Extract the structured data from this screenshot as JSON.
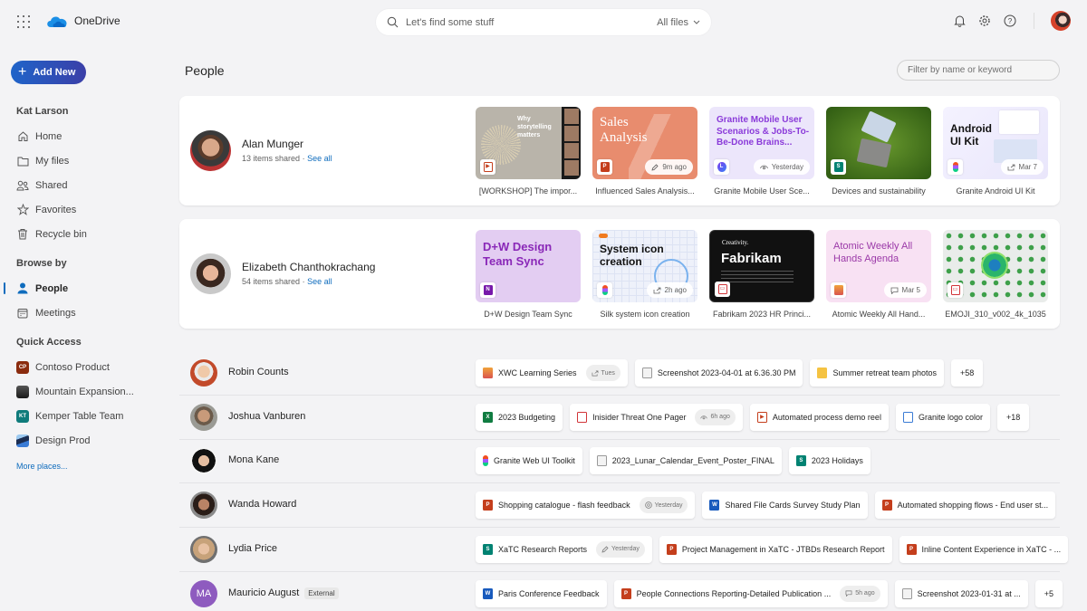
{
  "app": {
    "name": "OneDrive"
  },
  "search": {
    "placeholder": "Let's find some stuff",
    "scope": "All files"
  },
  "sidebar": {
    "add_new": "Add New",
    "user": "Kat Larson",
    "nav": [
      {
        "label": "Home",
        "icon": "home-icon"
      },
      {
        "label": "My files",
        "icon": "folder-icon"
      },
      {
        "label": "Shared",
        "icon": "people-icon"
      },
      {
        "label": "Favorites",
        "icon": "star-icon"
      },
      {
        "label": "Recycle bin",
        "icon": "trash-icon"
      }
    ],
    "browse_heading": "Browse by",
    "browse": [
      {
        "label": "People",
        "icon": "person-icon",
        "active": true
      },
      {
        "label": "Meetings",
        "icon": "calendar-icon"
      }
    ],
    "quick_heading": "Quick Access",
    "quick": [
      {
        "label": "Contoso Product",
        "badge": "CP",
        "color": "#8a2b0e"
      },
      {
        "label": "Mountain Expansion...",
        "badge": "",
        "color": "#2b2b2b"
      },
      {
        "label": "Kemper Table Team",
        "badge": "KT",
        "color": "#0f7b7b"
      },
      {
        "label": "Design Prod",
        "badge": "",
        "color": "#1e3a6b"
      }
    ],
    "more_places": "More places..."
  },
  "main": {
    "title": "People",
    "filter_placeholder": "Filter by name or keyword",
    "featured": [
      {
        "name": "Alan Munger",
        "items": "13 items shared",
        "see_all": "See all",
        "files": [
          {
            "name": "[WORKSHOP] The impor...",
            "thumb_title": "Why storytelling matters",
            "type": "video",
            "activity": ""
          },
          {
            "name": "Influenced Sales Analysis...",
            "thumb_title": "Sales Analysis",
            "type": "powerpoint",
            "activity": "9m ago",
            "activity_icon": "pencil-icon"
          },
          {
            "name": "Granite Mobile User Sce...",
            "thumb_title": "Granite Mobile User Scenarios & Jobs-To-Be-Done Brains...",
            "type": "loop",
            "activity": "Yesterday",
            "activity_icon": "eye-icon"
          },
          {
            "name": "Devices and sustainability",
            "thumb_title": "",
            "type": "sway",
            "activity": ""
          },
          {
            "name": "Granite Android UI Kit",
            "thumb_title": "Android UI Kit",
            "type": "figma",
            "activity": "Mar 7",
            "activity_icon": "share-icon"
          }
        ]
      },
      {
        "name": "Elizabeth Chanthokrachang",
        "items": "54 items shared",
        "see_all": "See all",
        "files": [
          {
            "name": "D+W Design Team Sync",
            "thumb_title": "D+W Design Team Sync",
            "type": "onenote",
            "activity": ""
          },
          {
            "name": "Silk system icon creation",
            "thumb_title": "System icon creation",
            "type": "figma",
            "activity": "2h ago",
            "activity_icon": "share-icon"
          },
          {
            "name": "Fabrikam 2023 HR Princi...",
            "thumb_title": "Fabrikam",
            "thumb_sub": "Creativity.",
            "type": "pdf",
            "activity": ""
          },
          {
            "name": "Atomic Weekly All Hand...",
            "thumb_title": "Atomic Weekly All Hands Agenda",
            "type": "forms",
            "activity": "Mar 5",
            "activity_icon": "comment-icon"
          },
          {
            "name": "EMOJI_310_v002_4k_1035",
            "thumb_title": "",
            "type": "pdf",
            "activity": ""
          }
        ]
      }
    ],
    "people": [
      {
        "name": "Robin Counts",
        "external": "",
        "files": [
          {
            "name": "XWC Learning Series",
            "type": "forms",
            "activity": "Tues",
            "activity_icon": "share-icon"
          },
          {
            "name": "Screenshot 2023-04-01 at 6.36.30 PM",
            "type": "image"
          },
          {
            "name": "Summer retreat team photos",
            "type": "folder"
          }
        ],
        "more": "+58"
      },
      {
        "name": "Joshua Vanburen",
        "external": "",
        "files": [
          {
            "name": "2023 Budgeting",
            "type": "excel"
          },
          {
            "name": "Inisider Threat One Pager",
            "type": "pdf",
            "activity": "6h ago",
            "activity_icon": "eye-icon"
          },
          {
            "name": "Automated process demo reel",
            "type": "video"
          },
          {
            "name": "Granite logo color",
            "type": "visio"
          }
        ],
        "more": "+18"
      },
      {
        "name": "Mona Kane",
        "external": "",
        "files": [
          {
            "name": "Granite Web UI Toolkit",
            "type": "figma"
          },
          {
            "name": "2023_Lunar_Calendar_Event_Poster_FINAL",
            "type": "image"
          },
          {
            "name": "2023 Holidays",
            "type": "sway"
          }
        ],
        "more": ""
      },
      {
        "name": "Wanda Howard",
        "external": "",
        "files": [
          {
            "name": "Shopping catalogue - flash feedback",
            "type": "powerpoint",
            "activity": "Yesterday",
            "activity_icon": "mention-icon"
          },
          {
            "name": "Shared File Cards Survey Study Plan",
            "type": "word"
          },
          {
            "name": "Automated shopping flows - End user st...",
            "type": "powerpoint"
          }
        ],
        "more": ""
      },
      {
        "name": "Lydia Price",
        "external": "",
        "files": [
          {
            "name": "XaTC Research Reports",
            "type": "sway",
            "activity": "Yesterday",
            "activity_icon": "pencil-icon"
          },
          {
            "name": "Project Management in XaTC - JTBDs Research Report",
            "type": "powerpoint"
          },
          {
            "name": "Inline Content Experience in XaTC - ...",
            "type": "powerpoint"
          }
        ],
        "more": ""
      },
      {
        "name": "Mauricio August",
        "initials": "MA",
        "external": "External",
        "files": [
          {
            "name": "Paris Conference Feedback",
            "type": "word"
          },
          {
            "name": "People Connections Reporting-Detailed Publication ...",
            "type": "powerpoint",
            "activity": "5h ago",
            "activity_icon": "comment-icon"
          },
          {
            "name": "Screenshot 2023-01-31 at ...",
            "type": "image"
          }
        ],
        "more": "+5"
      }
    ]
  },
  "colors": {
    "accent": "#0f6cbd",
    "add_new_start": "#1f64c9",
    "add_new_end": "#3b3fa8",
    "powerpoint": "#c43e1c",
    "word": "#185abd",
    "excel": "#107c41",
    "onenote": "#7719aa",
    "sway": "#008272",
    "pdf": "#d13438"
  }
}
